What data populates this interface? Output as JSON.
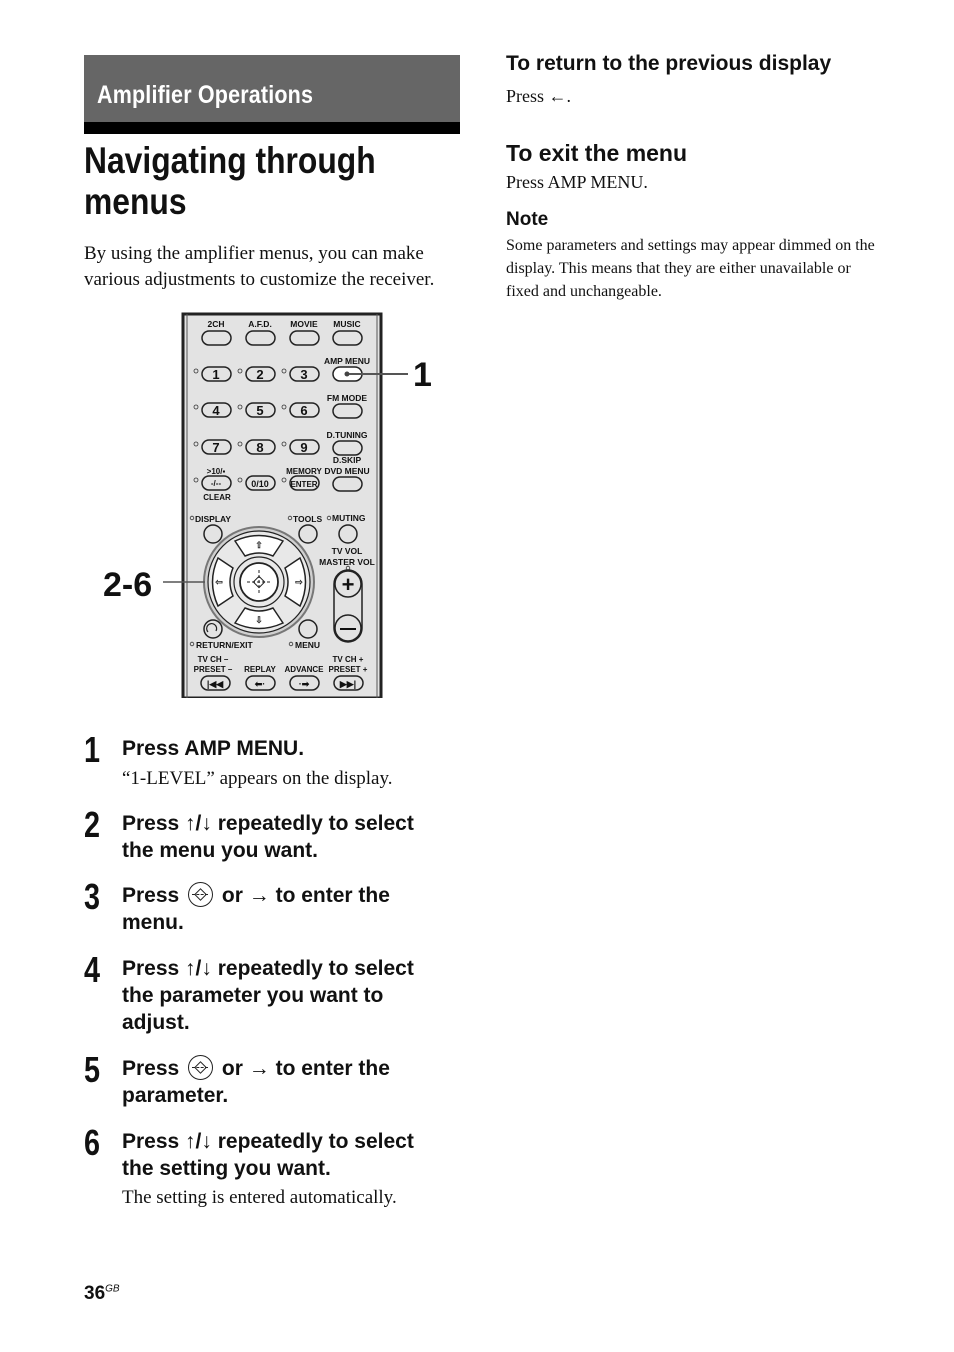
{
  "header": {
    "section": "Amplifier Operations",
    "title": "Navigating through menus",
    "intro": "By using the amplifier menus, you can make various adjustments to customize the receiver."
  },
  "remote": {
    "callout_1": "1",
    "callout_2_6": "2-6",
    "top_buttons": [
      "2CH",
      "A.F.D.",
      "MOVIE",
      "MUSIC"
    ],
    "right_labels": [
      "AMP MENU",
      "FM MODE",
      "D.TUNING",
      "D.SKIP",
      "DVD MENU"
    ],
    "number_keys": [
      "1",
      "2",
      "3",
      "4",
      "5",
      "6",
      "7",
      "8",
      "9"
    ],
    "key_10_top": ">10/▪",
    "key_10_mid": "-/--",
    "key_10_bottom": "CLEAR",
    "key_0": "0/10",
    "memory_label": "MEMORY",
    "enter_label": "ENTER",
    "display_label": "DISPLAY",
    "tools_label": "TOOLS",
    "muting_label": "MUTING",
    "tv_vol_label": "TV VOL",
    "master_vol_label": "MASTER VOL",
    "return_label": "RETURN/EXIT",
    "menu_label": "MENU",
    "tvch_minus_1": "TV CH –",
    "tvch_minus_2": "PRESET –",
    "replay_label": "REPLAY",
    "advance_label": "ADVANCE",
    "tvch_plus_1": "TV CH +",
    "tvch_plus_2": "PRESET +"
  },
  "steps": [
    {
      "num": "1",
      "text": "Press AMP MENU.",
      "sub": "“1-LEVEL” appears on the display."
    },
    {
      "num": "2",
      "text_a": "Press ↑/↓ repeatedly to select",
      "text_b": "the menu you want."
    },
    {
      "num": "3",
      "text_a": "Press",
      "text_b": "or → to enter the",
      "text_c": "menu."
    },
    {
      "num": "4",
      "text_a": "Press ↑/↓ repeatedly to select",
      "text_b": "the parameter you want to",
      "text_c": "adjust."
    },
    {
      "num": "5",
      "text_a": "Press",
      "text_b": "or → to enter the",
      "text_c": "parameter."
    },
    {
      "num": "6",
      "text_a": "Press ↑/↓ repeatedly to select",
      "text_b": "the setting you want.",
      "sub": "The setting is entered automatically."
    }
  ],
  "right": {
    "return_heading": "To return to the previous display",
    "return_text": "Press ←.",
    "exit_heading": "To exit the menu",
    "exit_text": "Press AMP MENU.",
    "note_heading": "Note",
    "note_text": "Some parameters and settings may appear dimmed on the display. This means that they are either unavailable or fixed and unchangeable."
  },
  "footer": {
    "page": "36",
    "suffix": "GB"
  }
}
